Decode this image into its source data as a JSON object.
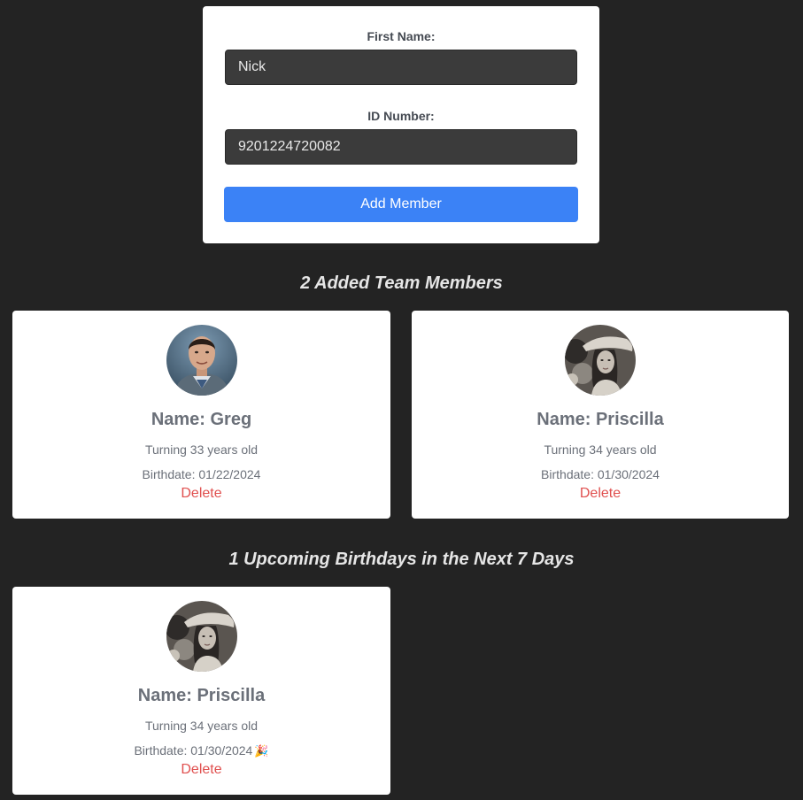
{
  "form": {
    "first_name_label": "First Name:",
    "first_name_value": "Nick",
    "id_label": "ID Number:",
    "id_value": "9201224720082",
    "add_button_label": "Add Member"
  },
  "team": {
    "heading": "2 Added Team Members",
    "members": [
      {
        "name": "Name: Greg",
        "age": "Turning 33 years old",
        "birthdate": "Birthdate: 01/22/2024",
        "delete_label": "Delete",
        "avatar_icon": "man-portrait-avatar"
      },
      {
        "name": "Name: Priscilla",
        "age": "Turning 34 years old",
        "birthdate": "Birthdate: 01/30/2024",
        "delete_label": "Delete",
        "avatar_icon": "woman-portrait-avatar"
      }
    ]
  },
  "upcoming": {
    "heading": "1 Upcoming Birthdays in the Next 7 Days",
    "members": [
      {
        "name": "Name: Priscilla",
        "age": "Turning 34 years old",
        "birthdate": "Birthdate: 01/30/2024",
        "party_emoji": "🎉",
        "delete_label": "Delete",
        "avatar_icon": "woman-portrait-avatar"
      }
    ]
  },
  "colors": {
    "page_background": "#232323",
    "card_background": "#ffffff",
    "input_background": "#3b3b3b",
    "primary_button": "#3b82f6",
    "delete_text": "#e0504f",
    "card_text": "#6b7079"
  }
}
